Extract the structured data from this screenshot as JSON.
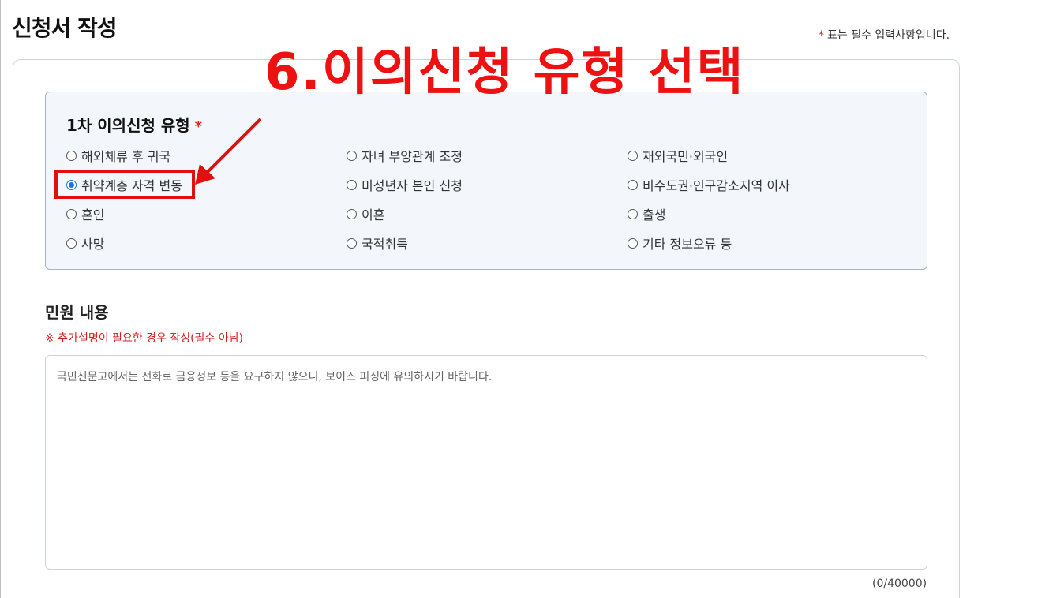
{
  "page": {
    "title": "신청서 작성",
    "required_star": "*",
    "required_note": "표는 필수 입력사항입니다."
  },
  "annotation": {
    "title": "6.이의신청 유형 선택",
    "highlight_color": "#e01010"
  },
  "objection_type": {
    "title": "1차 이의신청 유형",
    "required_star": "*",
    "selected": "취약계층 자격 변동",
    "options": [
      "해외체류 후 귀국",
      "자녀 부양관계 조정",
      "재외국민·외국인",
      "취약계층 자격 변동",
      "미성년자 본인 신청",
      "비수도권·인구감소지역 이사",
      "혼인",
      "이혼",
      "출생",
      "사망",
      "국적취득",
      "기타 정보오류 등"
    ]
  },
  "complaint": {
    "title": "민원 내용",
    "note": "※ 추가설명이 필요한 경우 작성(필수 아님)",
    "placeholder": "국민신문고에서는 전화로 금융정보 등을 요구하지 않으니, 보이스 피싱에 유의하시기 바랍니다.",
    "value": "",
    "counter": "(0/40000)"
  },
  "colors": {
    "accent_red": "#e02020",
    "radio_selected": "#1a73e8",
    "panel_bg": "#f3f6fa"
  }
}
